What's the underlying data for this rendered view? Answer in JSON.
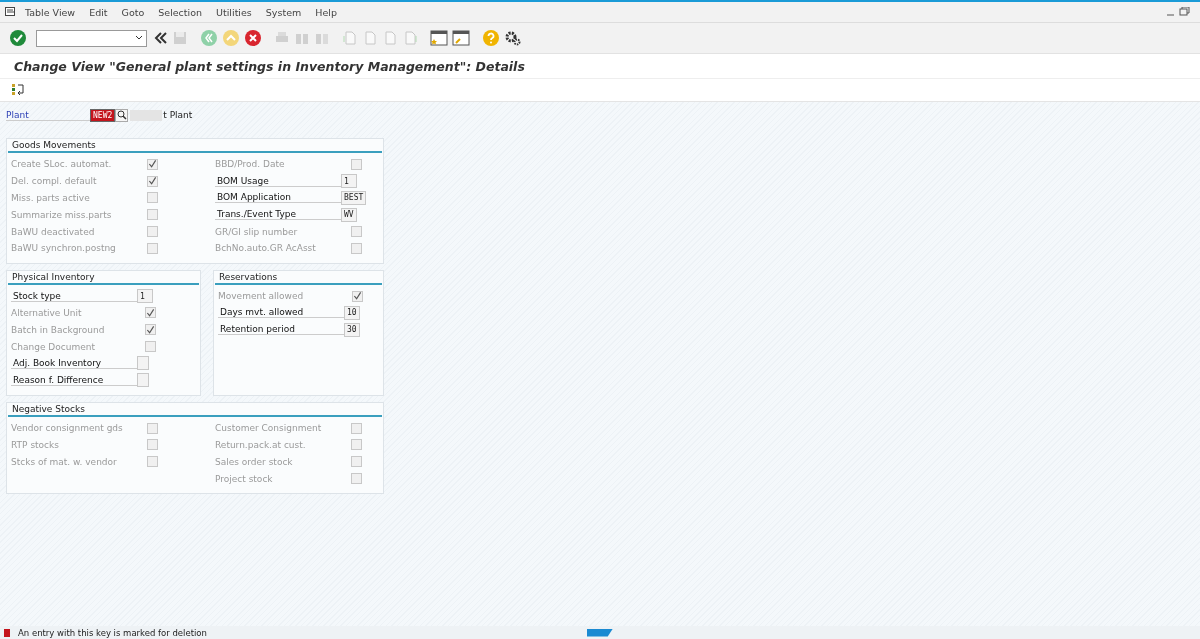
{
  "menu": [
    "Table View",
    "Edit",
    "Goto",
    "Selection",
    "Utilities",
    "System",
    "Help"
  ],
  "title": "Change View \"General plant settings in Inventory Management\": Details",
  "plant": {
    "label": "Plant",
    "value": "NEW2",
    "description": "t Plant"
  },
  "sections": [
    {
      "title": "Goods Movements",
      "wide": true,
      "columns": [
        [
          {
            "kind": "checkbox",
            "label": "Create SLoc. automat.",
            "checked": true
          },
          {
            "kind": "checkbox",
            "label": "Del. compl. default",
            "checked": true
          },
          {
            "kind": "checkbox",
            "label": "Miss. parts active",
            "checked": false
          },
          {
            "kind": "checkbox",
            "label": "Summarize miss.parts",
            "checked": false
          },
          {
            "kind": "checkbox",
            "label": "BaWU deactivated",
            "checked": false
          },
          {
            "kind": "checkbox",
            "label": "BaWU synchron.postng",
            "checked": false
          }
        ],
        [
          {
            "kind": "checkbox",
            "label": "BBD/Prod. Date",
            "checked": false
          },
          {
            "kind": "field",
            "label": "BOM Usage",
            "value": "1"
          },
          {
            "kind": "field",
            "label": "BOM Application",
            "value": "BEST"
          },
          {
            "kind": "field",
            "label": "Trans./Event Type",
            "value": "WV"
          },
          {
            "kind": "checkbox",
            "label": "GR/GI slip number",
            "checked": false
          },
          {
            "kind": "checkbox",
            "label": "BchNo.auto.GR AcAsst",
            "checked": false
          }
        ]
      ]
    },
    {
      "title": "Physical Inventory",
      "wide": false,
      "columns": [
        [
          {
            "kind": "field",
            "label": "Stock type",
            "value": "1"
          },
          {
            "kind": "checkbox",
            "label": "Alternative Unit",
            "checked": true
          },
          {
            "kind": "checkbox",
            "label": "Batch in Background",
            "checked": true
          },
          {
            "kind": "checkbox",
            "label": "Change Document",
            "checked": false
          },
          {
            "kind": "field",
            "label": "Adj. Book Inventory"
          },
          {
            "kind": "field",
            "label": "Reason f. Difference"
          }
        ]
      ]
    },
    {
      "title": "Reservations",
      "wide": false,
      "columns": [
        [
          {
            "kind": "checkbox",
            "label": "Movement allowed",
            "checked": true
          },
          {
            "kind": "field",
            "label": "Days mvt. allowed",
            "value": "10"
          },
          {
            "kind": "field",
            "label": "Retention period",
            "value": "30"
          }
        ]
      ]
    },
    {
      "title": "Negative Stocks",
      "wide": true,
      "columns": [
        [
          {
            "kind": "checkbox",
            "label": "Vendor consignment gds",
            "checked": false
          },
          {
            "kind": "checkbox",
            "label": "RTP stocks",
            "checked": false
          },
          {
            "kind": "checkbox",
            "label": "Stcks of mat. w. vendor",
            "checked": false
          }
        ],
        [
          {
            "kind": "checkbox",
            "label": "Customer Consignment",
            "checked": false
          },
          {
            "kind": "checkbox",
            "label": "Return.pack.at cust.",
            "checked": false
          },
          {
            "kind": "checkbox",
            "label": "Sales order stock",
            "checked": false
          },
          {
            "kind": "checkbox",
            "label": "Project stock",
            "checked": false
          }
        ]
      ]
    }
  ],
  "status": {
    "message": "An entry with this key is marked for deletion"
  }
}
